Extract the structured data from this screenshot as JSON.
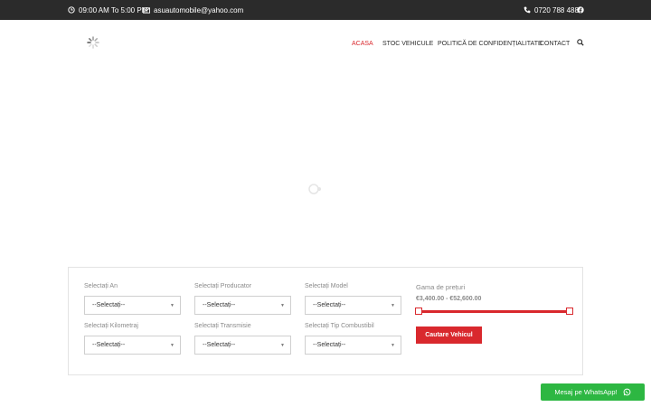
{
  "topbar": {
    "hours": "09:00 AM To 5:00 PM",
    "email": "asuautomobile@yahoo.com",
    "phone": "0720 788 488",
    "icons": [
      "clock-icon",
      "mail-icon",
      "phone-icon",
      "facebook-icon"
    ]
  },
  "nav": {
    "items": [
      {
        "label": "ACASA",
        "active": true
      },
      {
        "label": "STOC VEHICULE",
        "active": false
      },
      {
        "label": "POLITICĂ DE CONFIDENȚIALITATE",
        "active": false
      },
      {
        "label": "CONTACT",
        "active": false
      }
    ],
    "search_icon": "search-icon"
  },
  "colors": {
    "accent": "#d9282d",
    "topbar_bg": "#2b2b2b",
    "whatsapp": "#2db742"
  },
  "search": {
    "year_label": "Selectați An",
    "year_value": "--Selectați--",
    "maker_label": "Selectați Producator",
    "maker_value": "--Selectați--",
    "model_label": "Selectați Model",
    "model_value": "--Selectați--",
    "mileage_label": "Selectați Kilometraj",
    "mileage_value": "--Selectați--",
    "transmission_label": "Selectați Transmisie",
    "transmission_value": "--Selectați--",
    "fuel_label": "Selectați Tip Combustibil",
    "fuel_value": "--Selectați--",
    "price_label": "Gama de prețuri",
    "price_range": "€3,400.00 - €52,600.00",
    "button_label": "Cautare Vehicul"
  },
  "whatsapp": {
    "label": "Mesaj pe WhatsApp!"
  }
}
